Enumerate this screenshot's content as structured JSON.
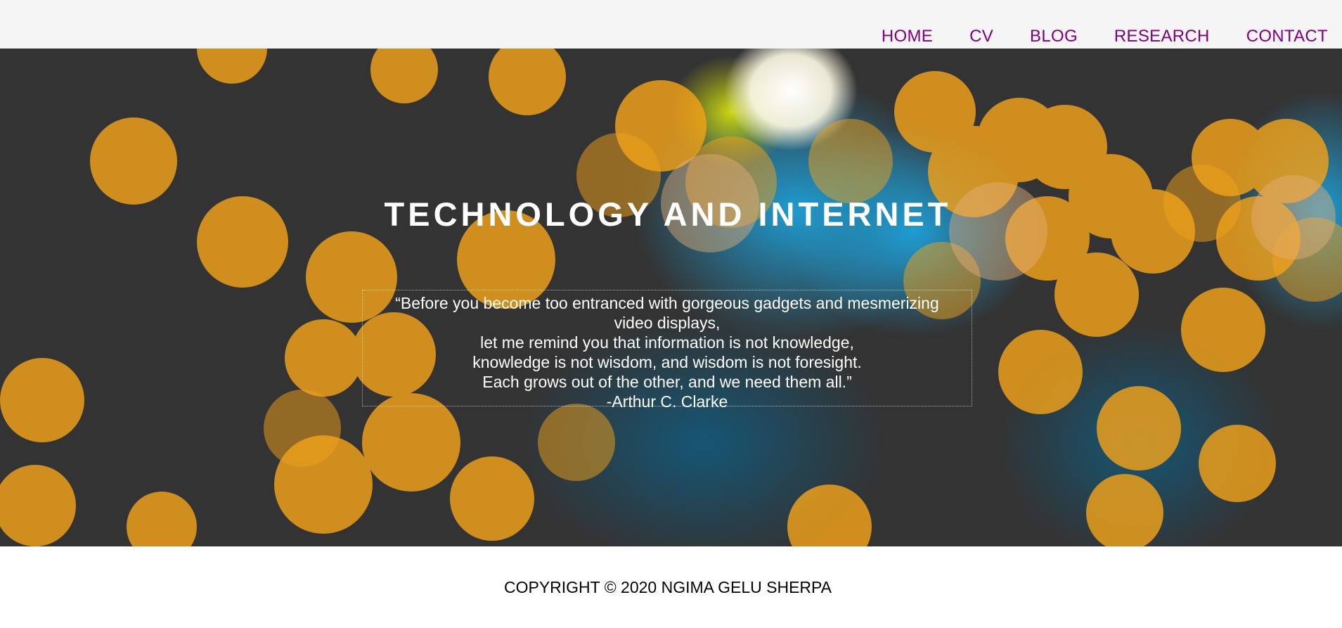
{
  "nav": {
    "items": [
      {
        "label": "HOME"
      },
      {
        "label": "CV"
      },
      {
        "label": "BLOG"
      },
      {
        "label": "RESEARCH"
      },
      {
        "label": "CONTACT"
      }
    ],
    "link_color": "#800080",
    "bar_color": "#f5f5f5"
  },
  "hero": {
    "title": "TECHNOLOGY AND INTERNET",
    "background_description_color": "#333333",
    "quote_lines": [
      "“Before you become too entranced with gorgeous gadgets and mesmerizing",
      "video displays,",
      "let me remind you that information is not knowledge,",
      "knowledge is not wisdom, and wisdom is not foresight.",
      "Each grows out of the other, and we need them all.”",
      "-Arthur C. Clarke"
    ],
    "bokeh_colors": {
      "orange": "#f2a21a",
      "blue": "#1ea0d8",
      "white": "#fffbe6",
      "yellow_green": "#c8d400"
    }
  },
  "footer": {
    "copyright": "COPYRIGHT © 2020 NGIMA GELU SHERPA"
  }
}
